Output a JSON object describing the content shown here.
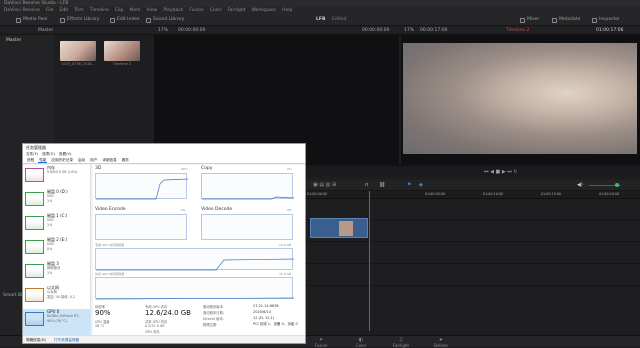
{
  "app": {
    "title": "DaVinci Resolve Studio - LFB",
    "menus": [
      "DaVinci Resolve",
      "File",
      "Edit",
      "Trim",
      "Timeline",
      "Clip",
      "Mark",
      "View",
      "Playback",
      "Fusion",
      "Color",
      "Fairlight",
      "Workspace",
      "Help"
    ]
  },
  "toolbar": {
    "media_pool": "Media Pool",
    "effects_library": "Effects Library",
    "edit_index": "Edit Index",
    "sound_library": "Sound Library",
    "project_name": "LFB",
    "edited": "Edited",
    "mixer": "Mixer",
    "metadata": "Metadata",
    "inspector": "Inspector"
  },
  "subbar": {
    "bin": "Master",
    "source_zoom": "17%",
    "source_tc_left": "00:00:00:00",
    "source_tc_right": "00:00:00:00",
    "prog_zoom": "17%",
    "prog_tc_left": "00:00:17:06",
    "timeline_name": "Timeline 2",
    "prog_tc_right": "01:00:17:06"
  },
  "leftpanel": {
    "master": "Master",
    "smart_bins": "Smart Bins"
  },
  "media": {
    "clips": [
      {
        "name": "1070_0738_2016...",
        "color": "#caa79a"
      },
      {
        "name": "Timeline 2",
        "color": "#b89083"
      }
    ]
  },
  "ruler": {
    "ticks": [
      "01:00:00:00",
      "01:00:05:00",
      "01:00:10:00",
      "01:00:15:00",
      "01:00:20:00",
      "01:00:25:00"
    ]
  },
  "pages": [
    {
      "label": "Fusion"
    },
    {
      "label": "Color"
    },
    {
      "label": "Fairlight"
    },
    {
      "label": "Deliver"
    }
  ],
  "taskmgr": {
    "title": "任务管理器",
    "menus": [
      "文件(F)",
      "选项(O)",
      "查看(V)"
    ],
    "tabs": [
      "进程",
      "性能",
      "应用历史记录",
      "启动",
      "用户",
      "详细信息",
      "服务"
    ],
    "items": [
      {
        "name": "内存",
        "sub": "9.8/63.9 GB (14%)",
        "color": "#a8589a"
      },
      {
        "name": "磁盘 0 (D:)",
        "sub": "SSD",
        "sub2": "1%",
        "color": "#3aa050"
      },
      {
        "name": "磁盘 1 (C:)",
        "sub": "SSD",
        "sub2": "1%",
        "color": "#3aa050"
      },
      {
        "name": "磁盘 2 (E:)",
        "sub": "USB",
        "sub2": "0%",
        "color": "#3aa050"
      },
      {
        "name": "磁盘 3",
        "sub": "网络驱动",
        "sub2": "1%",
        "color": "#3aa050"
      },
      {
        "name": "以太网",
        "sub": "以太网",
        "sub2": "发送: 40 接收: 0.2",
        "color": "#c07a2a"
      },
      {
        "name": "GPU 0",
        "sub": "NVIDIA GeForce RT...",
        "sub2": "90% (58 °C)",
        "color": "#3a76c0"
      }
    ],
    "graphs": {
      "g1": "3D",
      "g1_pct": "90%",
      "g2": "Copy",
      "g2_pct": "0%",
      "g3": "Video Encode",
      "g3_pct": "0%",
      "g4": "Video Decode",
      "g4_pct": "0%",
      "dedicated": "专用 GPU 内存使用量",
      "dedicated_max": "24.0 GB",
      "shared": "共享 GPU 内存使用量",
      "shared_max": "31.9 GB"
    },
    "stats": {
      "util_label": "利用率",
      "util": "90%",
      "gpumem_label": "专用 GPU 内存",
      "gpumem": "12.6/24.0 GB",
      "driver_label": "驱动程序版本:",
      "driver": "27.21.14.6638",
      "date_label": "驱动程序日期:",
      "date": "2020/6/14",
      "dx_label": "DirectX 版本:",
      "dx": "12 (FL 12.1)",
      "loc_label": "物理位置:",
      "loc": "PCI 总线 1、设备 0、功能 0",
      "temp_label": "GPU 温度",
      "temp": "58 °C",
      "shmem_label": "共享 GPU 内存",
      "shmem": "0.2/31.9 GB",
      "gpumem2_label": "GPU 内存"
    },
    "footer": {
      "fewer": "简略信息(D)",
      "resmon": "打开资源监视器"
    }
  }
}
